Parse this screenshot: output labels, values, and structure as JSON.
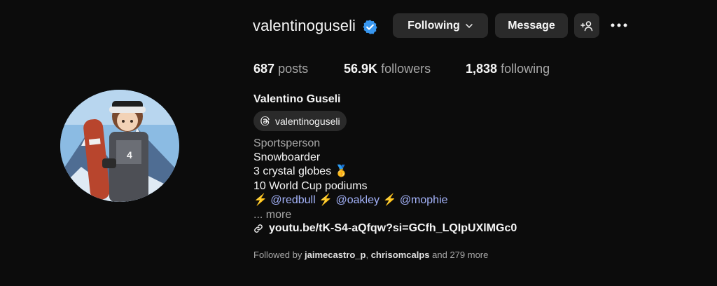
{
  "profile": {
    "username": "valentinoguseli",
    "verified": true,
    "full_name": "Valentino Guseli",
    "threads_handle": "valentinoguseli",
    "category": "Sportsperson"
  },
  "actions": {
    "following_label": "Following",
    "message_label": "Message"
  },
  "stats": {
    "posts_count": "687",
    "posts_label": "posts",
    "followers_count": "56.9K",
    "followers_label": "followers",
    "following_count": "1,838",
    "following_label": "following"
  },
  "bio": {
    "line1": "Snowboarder",
    "line2_text": "3 crystal globes",
    "line2_emoji": "🥇",
    "line3": "10 World Cup podiums",
    "bolt": "⚡",
    "mentions": [
      "@redbull",
      "@oakley",
      "@mophie"
    ],
    "more_label": "... more",
    "link": "youtu.be/tK-S4-aQfqw?si=GCfh_LQIpUXlMGc0"
  },
  "followed_by": {
    "prefix": "Followed by",
    "user1": "jaimecastro_p",
    "user2": "chrisomcalps",
    "suffix": "and 279 more"
  },
  "colors": {
    "background": "#0c0c0c",
    "button": "#2a2a2a",
    "verified": "#3897f0",
    "mention": "#a5b4fc",
    "muted": "#a8a8a8"
  }
}
